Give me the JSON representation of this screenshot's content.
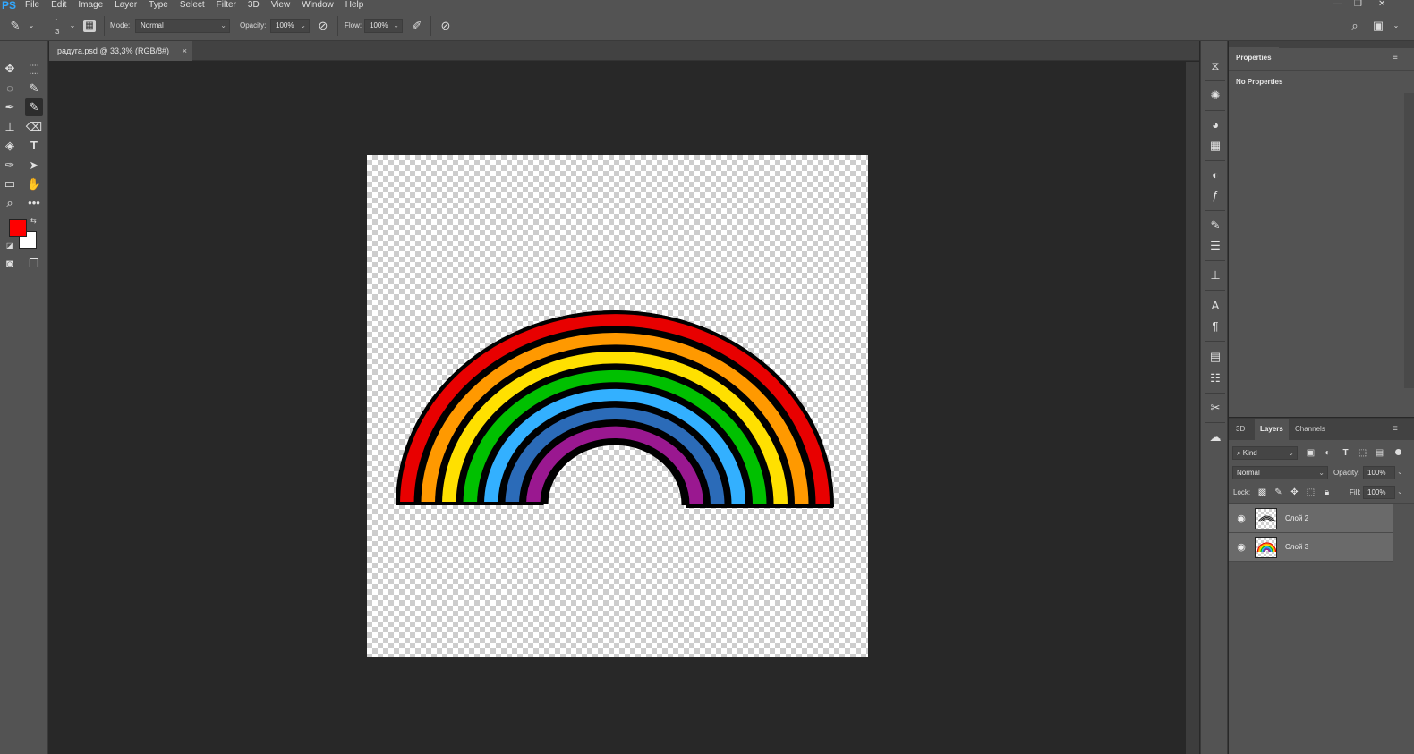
{
  "app": {
    "logo": "PS"
  },
  "menu": [
    "File",
    "Edit",
    "Image",
    "Layer",
    "Type",
    "Select",
    "Filter",
    "3D",
    "View",
    "Window",
    "Help"
  ],
  "options": {
    "brush_size": "3",
    "mode_label": "Mode:",
    "mode_value": "Normal",
    "opacity_label": "Opacity:",
    "opacity_value": "100%",
    "flow_label": "Flow:",
    "flow_value": "100%"
  },
  "document": {
    "tab_title": "радуга.psd @ 33,3% (RGB/8#)",
    "close": "×"
  },
  "colors": {
    "foreground": "#ff0000",
    "background": "#ffffff",
    "ps_blue": "#31a8ff"
  },
  "properties": {
    "tab": "Properties",
    "message": "No Properties"
  },
  "layers_panel": {
    "tabs": [
      "3D",
      "Layers",
      "Channels"
    ],
    "active_tab": "Layers",
    "filter_kind": "Kind",
    "blend_mode": "Normal",
    "opacity_label": "Opacity:",
    "opacity_value": "100%",
    "lock_label": "Lock:",
    "fill_label": "Fill:",
    "fill_value": "100%",
    "layers": [
      {
        "name": "Слой 2",
        "visible": true
      },
      {
        "name": "Слой 3",
        "visible": true
      }
    ]
  },
  "rainbow_colors": [
    "#e80000",
    "#ff9900",
    "#ffe000",
    "#00c000",
    "#33b0ff",
    "#2b6bb8",
    "#9a1890"
  ]
}
